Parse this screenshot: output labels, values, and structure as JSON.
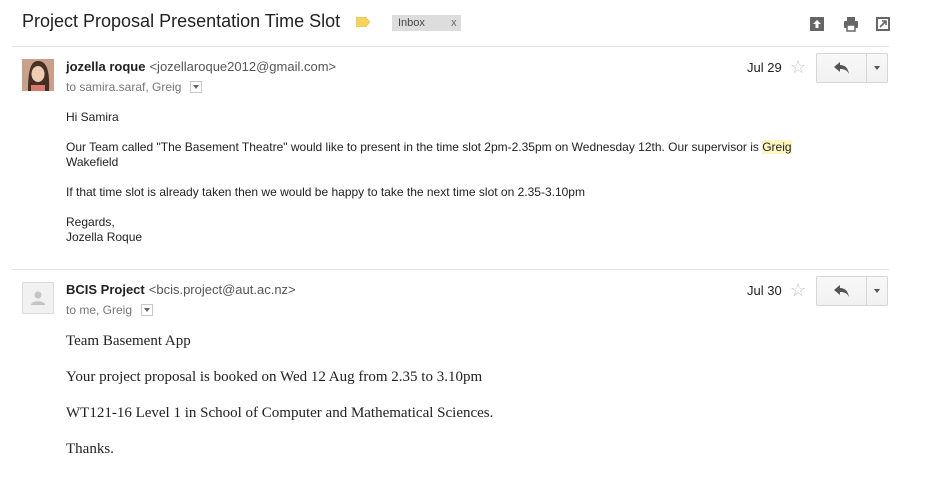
{
  "thread": {
    "subject": "Project Proposal Presentation Time Slot",
    "label_chip": "Inbox",
    "label_remove": "x",
    "header_icons": [
      "archive-icon",
      "print-icon",
      "new-window-icon"
    ],
    "label_color": "#f4d35e"
  },
  "messages": [
    {
      "sender_name": "jozella roque",
      "sender_email": "<jozellaroque2012@gmail.com>",
      "to": "to samira.saraf, Greig",
      "date": "Jul 29",
      "body": {
        "greeting": "Hi Samira",
        "p1_before": "Our Team called \"The Basement Theatre\" would like to present in the time slot 2pm-2.35pm on Wednesday 12th. Our supervisor is ",
        "p1_highlight": "Greig",
        "p1_after": "Wakefield",
        "p2": "If that time slot is already taken then we would be happy to take the next time slot on 2.35-3.10pm",
        "signoff": "Regards,",
        "signature": "Jozella Roque"
      }
    },
    {
      "sender_name": "BCIS Project",
      "sender_email": "<bcis.project@aut.ac.nz>",
      "to": "to me, Greig",
      "date": "Jul 30",
      "body": {
        "line1": "Team Basement App",
        "line2": "Your project proposal is booked on Wed 12 Aug from 2.35 to 3.10pm",
        "line3": "WT121-16 Level 1 in School of Computer and Mathematical Sciences.",
        "line4": "Thanks."
      }
    }
  ]
}
